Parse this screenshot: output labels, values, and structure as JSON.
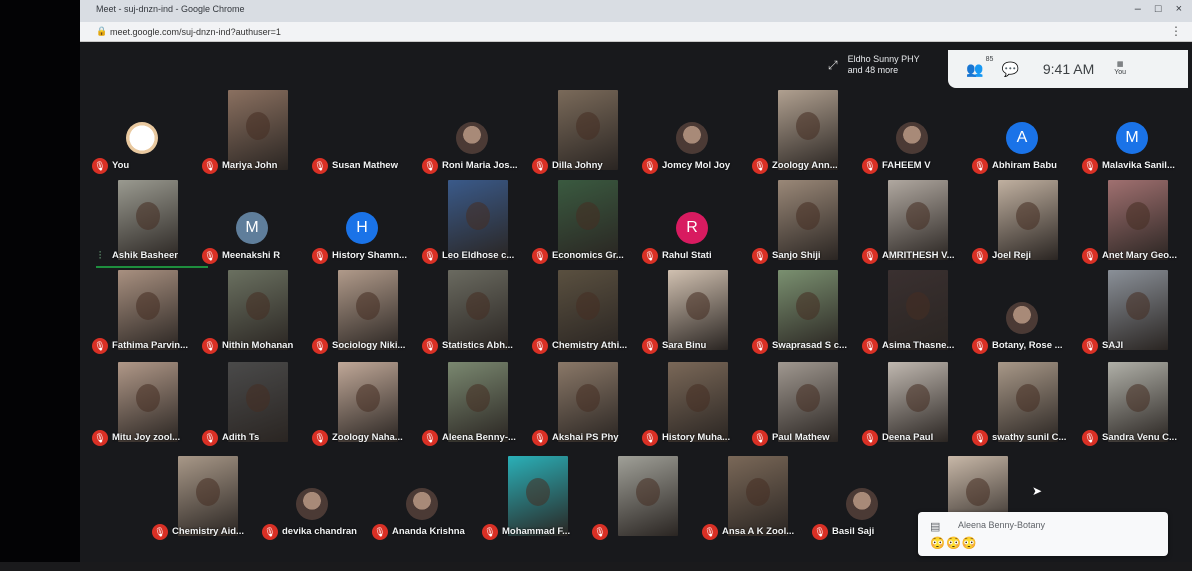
{
  "browser": {
    "tab_title": "Meet - suj-dnzn-ind - Google Chrome",
    "url": "meet.google.com/suj-dnzn-ind?authuser=1",
    "lock_icon": "lock-icon",
    "minimize": "–",
    "maximize": "□",
    "close": "×"
  },
  "meet": {
    "presenter": {
      "line1": "Eldho Sunny PHY",
      "line2": "and 48 more"
    },
    "participants_badge": "85",
    "time": "9:41 AM",
    "you_label": "You"
  },
  "chat_toast": {
    "sender": "Aleena Benny-Botany",
    "message": "😳😳😳"
  },
  "participants": [
    {
      "name": "You",
      "kind": "logo"
    },
    {
      "name": "Mariya John",
      "kind": "video",
      "color": "#8a7060"
    },
    {
      "name": "Susan Mathew",
      "kind": "none"
    },
    {
      "name": "Roni Maria Jos...",
      "kind": "photo"
    },
    {
      "name": "Dilla Johny",
      "kind": "video",
      "color": "#7a6a5a"
    },
    {
      "name": "Jomcy Mol Joy",
      "kind": "photo"
    },
    {
      "name": "Zoology Ann...",
      "kind": "video",
      "color": "#b0a090"
    },
    {
      "name": "FAHEEM V",
      "kind": "photo"
    },
    {
      "name": "Abhiram Babu",
      "kind": "letter",
      "letter": "A",
      "color": "#1a73e8"
    },
    {
      "name": "Malavika Sanil...",
      "kind": "letter",
      "letter": "M",
      "color": "#1a73e8"
    },
    {
      "name": "Ashik Basheer",
      "kind": "video",
      "color": "#9a9a90",
      "speaking": true
    },
    {
      "name": "Meenakshi R",
      "kind": "letter",
      "letter": "M",
      "color": "#5f7e9b"
    },
    {
      "name": "History Shamn...",
      "kind": "letter",
      "letter": "H",
      "color": "#1a73e8"
    },
    {
      "name": "Leo Eldhose c...",
      "kind": "video",
      "color": "#3a5a8a"
    },
    {
      "name": "Economics Gr...",
      "kind": "video",
      "color": "#3a5a40"
    },
    {
      "name": "Rahul Stati",
      "kind": "letter",
      "letter": "R",
      "color": "#d81b60"
    },
    {
      "name": "Sanjo Shiji",
      "kind": "video",
      "color": "#9a8878"
    },
    {
      "name": "AMRITHESH V...",
      "kind": "video",
      "color": "#b0a8a0"
    },
    {
      "name": "Joel Reji",
      "kind": "video",
      "color": "#c0b0a0"
    },
    {
      "name": "Anet Mary Geo...",
      "kind": "video",
      "color": "#a07070"
    },
    {
      "name": "Fathima Parvin...",
      "kind": "video",
      "color": "#a89080"
    },
    {
      "name": "Nithin Mohanan",
      "kind": "video",
      "color": "#6a7060"
    },
    {
      "name": "Sociology Niki...",
      "kind": "video",
      "color": "#b09a8a"
    },
    {
      "name": "Statistics Abh...",
      "kind": "video",
      "color": "#6a6a60"
    },
    {
      "name": "Chemistry Athi...",
      "kind": "video",
      "color": "#5a5040"
    },
    {
      "name": "Sara Binu",
      "kind": "video",
      "color": "#d0c0b0"
    },
    {
      "name": "Swaprasad S c...",
      "kind": "video",
      "color": "#7a9070"
    },
    {
      "name": "Asima Thasne...",
      "kind": "video",
      "color": "#3a3030"
    },
    {
      "name": "Botany, Rose ...",
      "kind": "photo"
    },
    {
      "name": "SAJI",
      "kind": "video",
      "color": "#8a9098"
    },
    {
      "name": "Mitu Joy zool...",
      "kind": "video",
      "color": "#b09888"
    },
    {
      "name": "Adith Ts",
      "kind": "video",
      "color": "#4a4a4a"
    },
    {
      "name": "Zoology Naha...",
      "kind": "video",
      "color": "#c0a898"
    },
    {
      "name": "Aleena Benny-...",
      "kind": "video",
      "color": "#7a8870"
    },
    {
      "name": "Akshai PS Phy",
      "kind": "video",
      "color": "#8a7868"
    },
    {
      "name": "History Muha...",
      "kind": "video",
      "color": "#7a6858"
    },
    {
      "name": "Paul Mathew",
      "kind": "video",
      "color": "#a09890"
    },
    {
      "name": "Deena Paul",
      "kind": "video",
      "color": "#c0b8b0"
    },
    {
      "name": "swathy sunil C...",
      "kind": "video",
      "color": "#a89888"
    },
    {
      "name": "Sandra Venu C...",
      "kind": "video",
      "color": "#b0b0a8"
    },
    {
      "name": "Chemistry Aid...",
      "kind": "video",
      "color": "#a89888"
    },
    {
      "name": "devika chandran",
      "kind": "photo"
    },
    {
      "name": "Ananda Krishna",
      "kind": "photo"
    },
    {
      "name": "Mohammad F...",
      "kind": "video",
      "color": "#2ab0b8"
    },
    {
      "name": "",
      "kind": "video",
      "color": "#a0a098"
    },
    {
      "name": "Ansa A K Zool...",
      "kind": "video",
      "color": "#7a6858"
    },
    {
      "name": "Basil Saji",
      "kind": "photo"
    },
    {
      "name": "",
      "kind": "video",
      "color": "#c8b8a8"
    }
  ]
}
